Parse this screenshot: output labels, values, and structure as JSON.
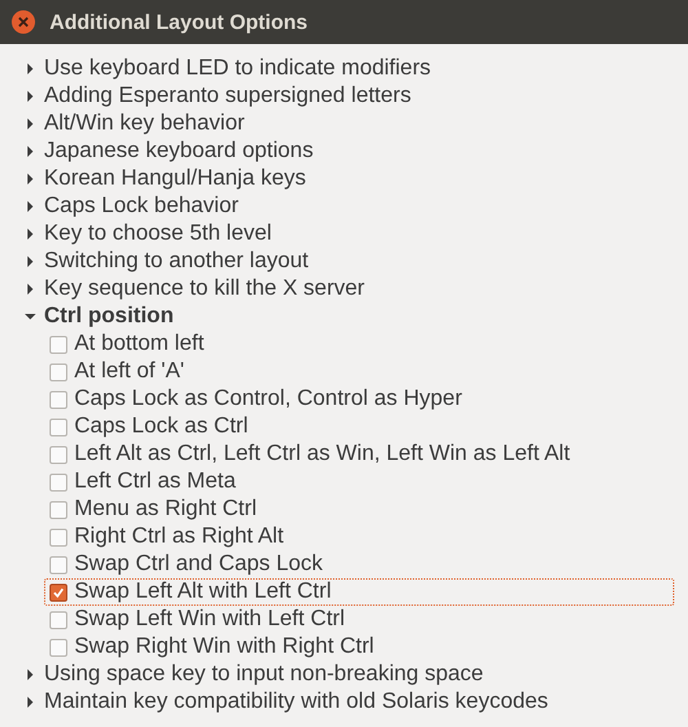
{
  "window": {
    "title": "Additional Layout Options"
  },
  "options": [
    {
      "label": "Use keyboard LED to indicate modifiers",
      "expanded": false
    },
    {
      "label": "Adding Esperanto supersigned letters",
      "expanded": false
    },
    {
      "label": "Alt/Win key behavior",
      "expanded": false
    },
    {
      "label": "Japanese keyboard options",
      "expanded": false
    },
    {
      "label": "Korean Hangul/Hanja keys",
      "expanded": false
    },
    {
      "label": "Caps Lock behavior",
      "expanded": false
    },
    {
      "label": "Key to choose 5th level",
      "expanded": false
    },
    {
      "label": "Switching to another layout",
      "expanded": false
    },
    {
      "label": "Key sequence to kill the X server",
      "expanded": false
    },
    {
      "label": "Ctrl position",
      "expanded": true,
      "children": [
        {
          "label": "At bottom left",
          "checked": false,
          "selected": false
        },
        {
          "label": "At left of 'A'",
          "checked": false,
          "selected": false
        },
        {
          "label": "Caps Lock as Control, Control as Hyper",
          "checked": false,
          "selected": false
        },
        {
          "label": "Caps Lock as Ctrl",
          "checked": false,
          "selected": false
        },
        {
          "label": "Left Alt as Ctrl, Left Ctrl as Win, Left Win as Left Alt",
          "checked": false,
          "selected": false
        },
        {
          "label": "Left Ctrl as Meta",
          "checked": false,
          "selected": false
        },
        {
          "label": "Menu as Right Ctrl",
          "checked": false,
          "selected": false
        },
        {
          "label": "Right Ctrl as Right Alt",
          "checked": false,
          "selected": false
        },
        {
          "label": "Swap Ctrl and Caps Lock",
          "checked": false,
          "selected": false
        },
        {
          "label": "Swap Left Alt with Left Ctrl",
          "checked": true,
          "selected": true
        },
        {
          "label": "Swap Left Win with Left Ctrl",
          "checked": false,
          "selected": false
        },
        {
          "label": "Swap Right Win with Right Ctrl",
          "checked": false,
          "selected": false
        }
      ]
    },
    {
      "label": "Using space key to input non-breaking space",
      "expanded": false
    },
    {
      "label": "Maintain key compatibility with old Solaris keycodes",
      "expanded": false
    }
  ]
}
